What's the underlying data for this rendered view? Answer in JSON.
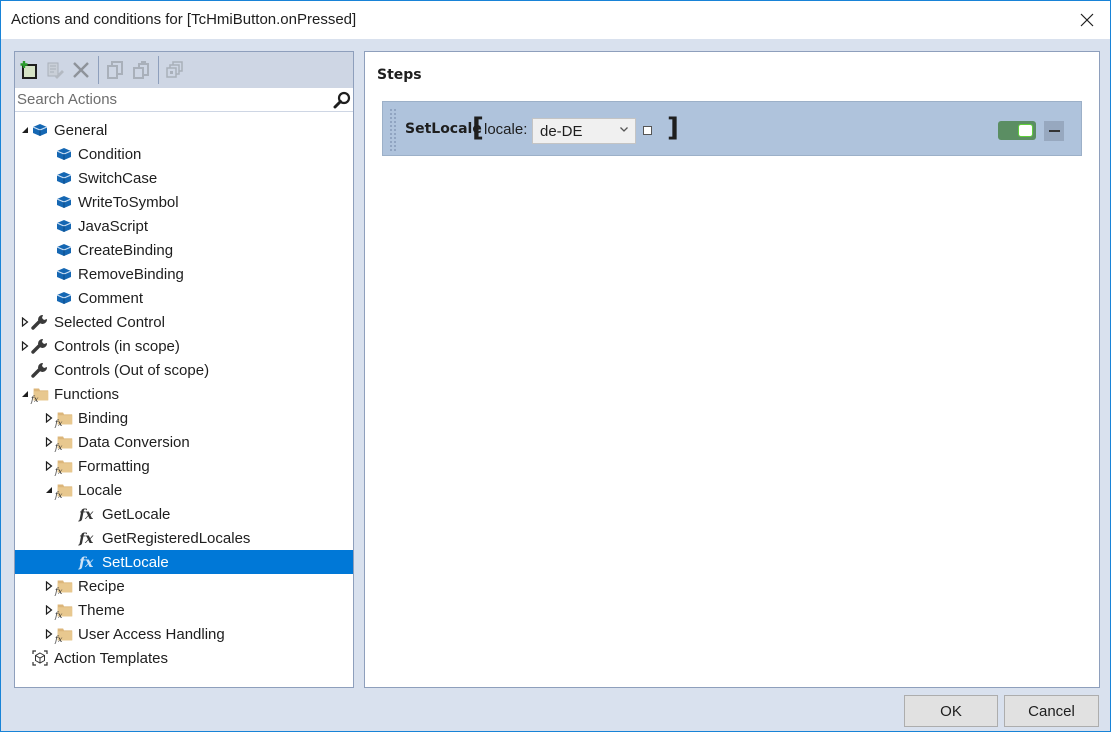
{
  "window": {
    "title": "Actions and conditions for [TcHmiButton.onPressed]",
    "close_icon": "close-icon"
  },
  "toolbar": {
    "buttons": [
      {
        "name": "add-action",
        "icon": "add-icon",
        "enabled": true
      },
      {
        "name": "edit-action",
        "icon": "edit-icon",
        "enabled": false
      },
      {
        "name": "delete-action",
        "icon": "delete-icon",
        "enabled": false
      },
      {
        "name": "copy-action",
        "icon": "copy-icon",
        "enabled": false
      },
      {
        "name": "paste-action",
        "icon": "paste-icon",
        "enabled": false
      },
      {
        "name": "create-template",
        "icon": "template-icon",
        "enabled": false
      }
    ]
  },
  "search": {
    "placeholder": "Search Actions",
    "value": ""
  },
  "tree": {
    "items": [
      {
        "label": "General",
        "level": 0,
        "expander": "expanded",
        "icon": "cube-icon"
      },
      {
        "label": "Condition",
        "level": 1,
        "expander": "none",
        "icon": "cube-icon"
      },
      {
        "label": "SwitchCase",
        "level": 1,
        "expander": "none",
        "icon": "cube-icon"
      },
      {
        "label": "WriteToSymbol",
        "level": 1,
        "expander": "none",
        "icon": "cube-icon"
      },
      {
        "label": "JavaScript",
        "level": 1,
        "expander": "none",
        "icon": "cube-icon"
      },
      {
        "label": "CreateBinding",
        "level": 1,
        "expander": "none",
        "icon": "cube-icon"
      },
      {
        "label": "RemoveBinding",
        "level": 1,
        "expander": "none",
        "icon": "cube-icon"
      },
      {
        "label": "Comment",
        "level": 1,
        "expander": "none",
        "icon": "cube-icon"
      },
      {
        "label": "Selected Control",
        "level": 0,
        "expander": "collapsed",
        "icon": "wrench-icon"
      },
      {
        "label": "Controls (in scope)",
        "level": 0,
        "expander": "collapsed",
        "icon": "wrench-icon"
      },
      {
        "label": "Controls (Out of scope)",
        "level": 0,
        "expander": "none",
        "icon": "wrench-icon"
      },
      {
        "label": "Functions",
        "level": 0,
        "expander": "expanded",
        "icon": "function-folder-icon"
      },
      {
        "label": "Binding",
        "level": 1,
        "expander": "collapsed",
        "icon": "function-folder-icon"
      },
      {
        "label": "Data Conversion",
        "level": 1,
        "expander": "collapsed",
        "icon": "function-folder-icon"
      },
      {
        "label": "Formatting",
        "level": 1,
        "expander": "collapsed",
        "icon": "function-folder-icon"
      },
      {
        "label": "Locale",
        "level": 1,
        "expander": "expanded",
        "icon": "function-folder-icon"
      },
      {
        "label": "GetLocale",
        "level": 2,
        "expander": "none",
        "icon": "function-icon"
      },
      {
        "label": "GetRegisteredLocales",
        "level": 2,
        "expander": "none",
        "icon": "function-icon"
      },
      {
        "label": "SetLocale",
        "level": 2,
        "expander": "none",
        "icon": "function-icon",
        "selected": true
      },
      {
        "label": "Recipe",
        "level": 1,
        "expander": "collapsed",
        "icon": "function-folder-icon"
      },
      {
        "label": "Theme",
        "level": 1,
        "expander": "collapsed",
        "icon": "function-folder-icon"
      },
      {
        "label": "User Access Handling",
        "level": 1,
        "expander": "collapsed",
        "icon": "function-folder-icon"
      },
      {
        "label": "Action Templates",
        "level": 0,
        "expander": "none",
        "icon": "template-icon"
      }
    ]
  },
  "steps": {
    "heading": "Steps",
    "items": [
      {
        "name": "SetLocale",
        "open_bracket": "[",
        "close_bracket": "]",
        "param_label": "locale:",
        "param_value": "de-DE",
        "param_checkbox_checked": false,
        "enabled": true
      }
    ]
  },
  "footer": {
    "ok_label": "OK",
    "cancel_label": "Cancel"
  },
  "colors": {
    "selection": "#0078d7",
    "window_border": "#1883d7",
    "step_card": "#afc3dc",
    "toggle_on": "#5b8e63"
  }
}
